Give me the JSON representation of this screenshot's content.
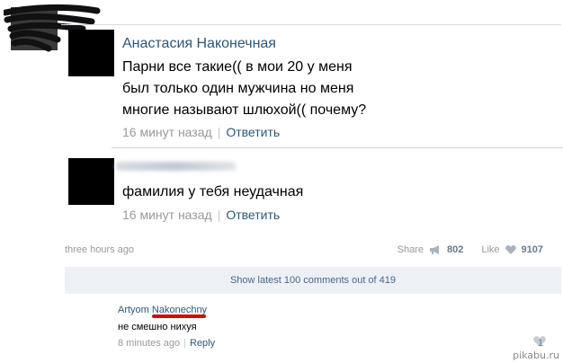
{
  "post": {
    "author_name": "Анастасия Наконечная",
    "message_lines": [
      "Парни все такие(( в мои 20 у меня",
      "был только один мужчина но меня",
      "многие называют шлюхой(( почему?"
    ],
    "time": "16 минут назад",
    "separator": "|",
    "reply_label": "Ответить"
  },
  "comment_reply": {
    "message": "фамилия у тебя неудачная",
    "time": "16 минут назад",
    "separator": "|",
    "reply_label": "Ответить"
  },
  "footer": {
    "time": "three hours ago",
    "share_label": "Share",
    "share_count": "802",
    "like_label": "Like",
    "like_count": "9107",
    "share_icon": "megaphone-icon",
    "like_icon": "heart-icon"
  },
  "show_more": {
    "label": "Show latest 100 comments out of 419"
  },
  "comment": {
    "author_first": "Artyom",
    "author_last": "Nakonechny",
    "text": "не смешно нихуя",
    "time": "8 minutes ago",
    "separator": "|",
    "reply_label": "Reply",
    "like_count": "1"
  },
  "watermark": "pikabu.ru",
  "colors": {
    "link": "#2b587a",
    "muted": "#999999",
    "show_more_bg": "#edf0f4",
    "underline": "#d20a0a"
  }
}
